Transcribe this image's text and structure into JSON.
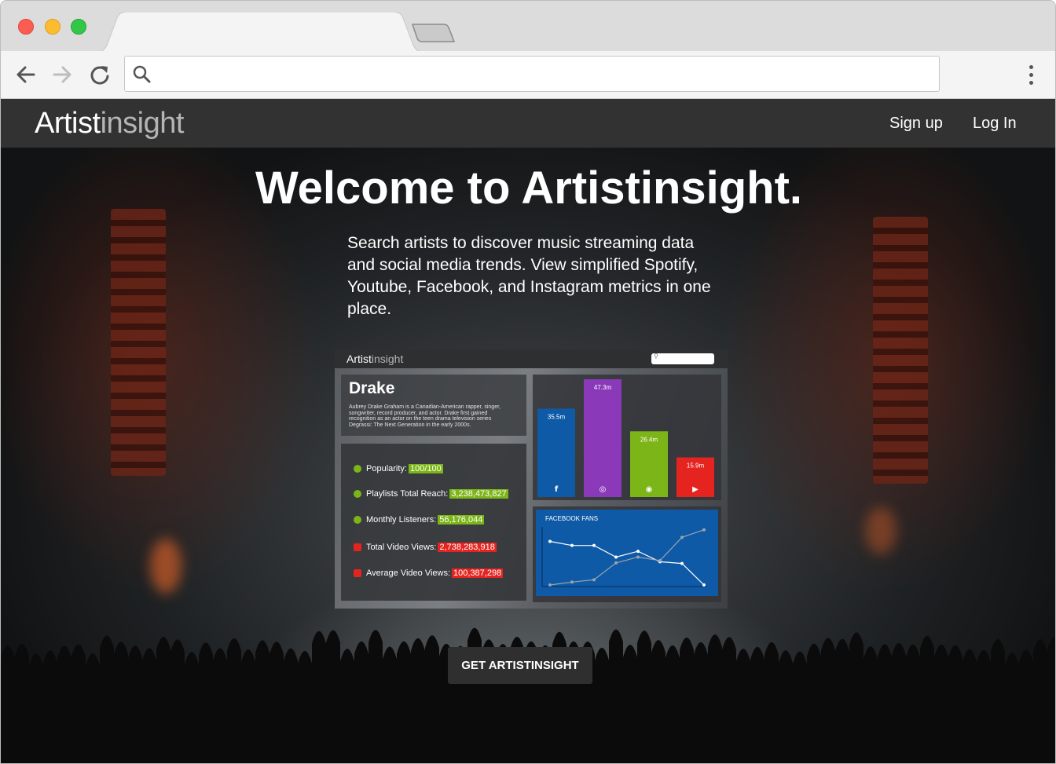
{
  "browser": {
    "tab_title": "",
    "address": ""
  },
  "site": {
    "logo_bold": "Artist",
    "logo_light": "insight",
    "nav": {
      "signup": "Sign up",
      "login": "Log In"
    }
  },
  "hero": {
    "title": "Welcome to Artistinsight.",
    "intro": "Search artists to discover music streaming data and social media trends. View simplified Spotify, Youtube, Facebook, and Instagram metrics in one place.",
    "cta": "GET ARTISTINSIGHT"
  },
  "preview": {
    "logo_bold": "Artist",
    "logo_light": "insight",
    "artist_name": "Drake",
    "bio": "Aubrey Drake Graham is a Canadian-American rapper, singer, songwriter, record producer, and actor. Drake first gained recognition as an actor on the teen drama television series Degrassi: The Next Generation in the early 2000s.",
    "stats": [
      {
        "icon": "spotify-icon",
        "label": "Popularity:",
        "value": "100/100",
        "color": "green"
      },
      {
        "icon": "spotify-icon",
        "label": "Playlists Total Reach:",
        "value": "3,238,473,827",
        "color": "green"
      },
      {
        "icon": "spotify-icon",
        "label": "Monthly Listeners:",
        "value": "56,176,044",
        "color": "green"
      },
      {
        "icon": "youtube-icon",
        "label": "Total Video Views:",
        "value": "2,738,283,918",
        "color": "red"
      },
      {
        "icon": "youtube-icon",
        "label": "Average Video Views:",
        "value": "100,387,298",
        "color": "red"
      }
    ],
    "colors": {
      "facebook": "#0f5aa6",
      "instagram": "#8a3ab9",
      "spotify": "#7cb518",
      "youtube": "#e52420"
    }
  },
  "chart_data": [
    {
      "type": "bar",
      "categories": [
        "facebook",
        "instagram",
        "spotify",
        "youtube"
      ],
      "labels": [
        "35.5m",
        "47.3m",
        "26.4m",
        "15.9m"
      ],
      "values": [
        35.5,
        47.3,
        26.4,
        15.9
      ],
      "colors": [
        "#0f5aa6",
        "#8a3ab9",
        "#7cb518",
        "#e52420"
      ],
      "icons": [
        "facebook-icon",
        "instagram-icon",
        "spotify-icon",
        "youtube-icon"
      ]
    },
    {
      "type": "line",
      "title": "FACEBOOK FANS",
      "x": [
        1,
        2,
        3,
        4,
        5,
        6,
        7,
        8
      ],
      "series": [
        {
          "values": [
            75,
            68,
            68,
            48,
            58,
            40,
            37,
            0
          ],
          "color": "#ffffff"
        },
        {
          "values": [
            0,
            5,
            9,
            38,
            48,
            42,
            82,
            95
          ],
          "color": "#9aa4ad"
        }
      ],
      "ylim": [
        0,
        100
      ]
    }
  ]
}
